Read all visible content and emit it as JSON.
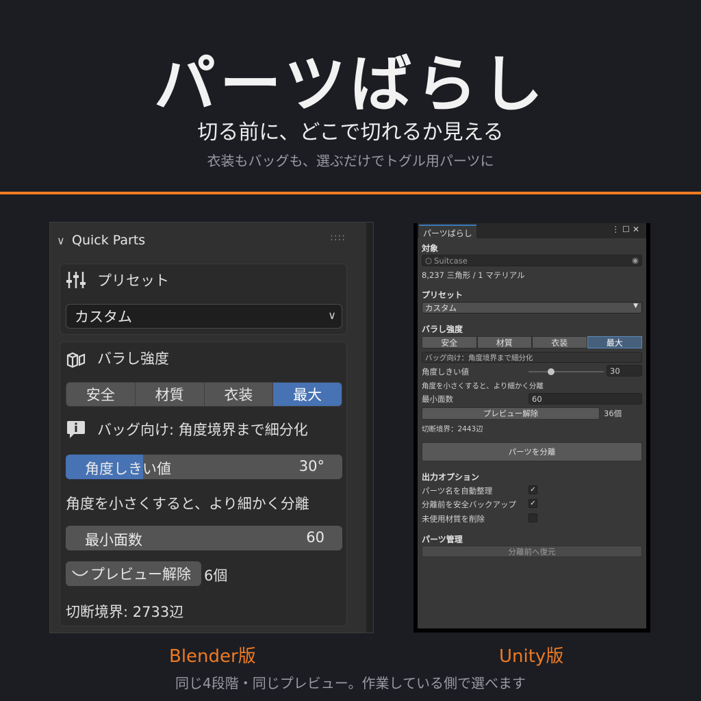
{
  "hero": {
    "title": "パーツばらし",
    "subtitle": "切る前に、どこで切れるか見える",
    "tagline": "衣装もバッグも、選ぶだけでトグル用パーツに"
  },
  "colors": {
    "accent": "#ef7a22",
    "blender_blue": "#4772b3",
    "unity_tab": "#3a79bb"
  },
  "blender": {
    "panel_title": "Quick Parts",
    "preset_label": "プリセット",
    "preset_value": "カスタム",
    "strength_label": "バラし強度",
    "modes": [
      "安全",
      "材質",
      "衣装",
      "最大"
    ],
    "active_mode": "最大",
    "info": "バッグ向け: 角度境界まで細分化",
    "angle_label": "角度しきい値",
    "angle_value": "30°",
    "angle_fraction": 0.28,
    "angle_hint": "角度を小さくすると、より細かく分離",
    "min_faces_label": "最小面数",
    "min_faces_value": "60",
    "preview_button": "プレビュー解除",
    "parts_count": "6個",
    "cut_edges": "切断境界: 2733辺",
    "icons": [
      "chevron-down-icon",
      "sliders-icon",
      "boxes-icon",
      "info-icon",
      "curve-icon"
    ]
  },
  "unity": {
    "tab_title": "パーツばらし",
    "target_header": "対象",
    "target_object": "Suitcase",
    "mesh_info": "8,237 三角形 / 1 マテリアル",
    "preset_header": "プリセット",
    "preset_value": "カスタム",
    "strength_header": "バラし強度",
    "modes": [
      "安全",
      "材質",
      "衣装",
      "最大"
    ],
    "active_mode": "最大",
    "info": "バッグ向け：角度境界まで細分化",
    "angle_label": "角度しきい値",
    "angle_value": "30",
    "angle_fraction": 0.3,
    "angle_hint": "角度を小さくすると、より細かく分離",
    "min_faces_label": "最小面数",
    "min_faces_value": "60",
    "preview_button": "プレビュー解除",
    "parts_count": "36個",
    "cut_edges": "切断境界：2443辺",
    "split_button": "パーツを分離",
    "output_header": "出力オプション",
    "options": [
      {
        "label": "パーツ名を自動整理",
        "checked": true
      },
      {
        "label": "分離前を安全バックアップ",
        "checked": true
      },
      {
        "label": "未使用材質を削除",
        "checked": false
      }
    ],
    "manage_header": "パーツ管理",
    "restore_button": "分離前へ復元"
  },
  "captions": {
    "blender": "Blender版",
    "unity": "Unity版",
    "footer": "同じ4段階・同じプレビュー。作業している側で選べます"
  }
}
